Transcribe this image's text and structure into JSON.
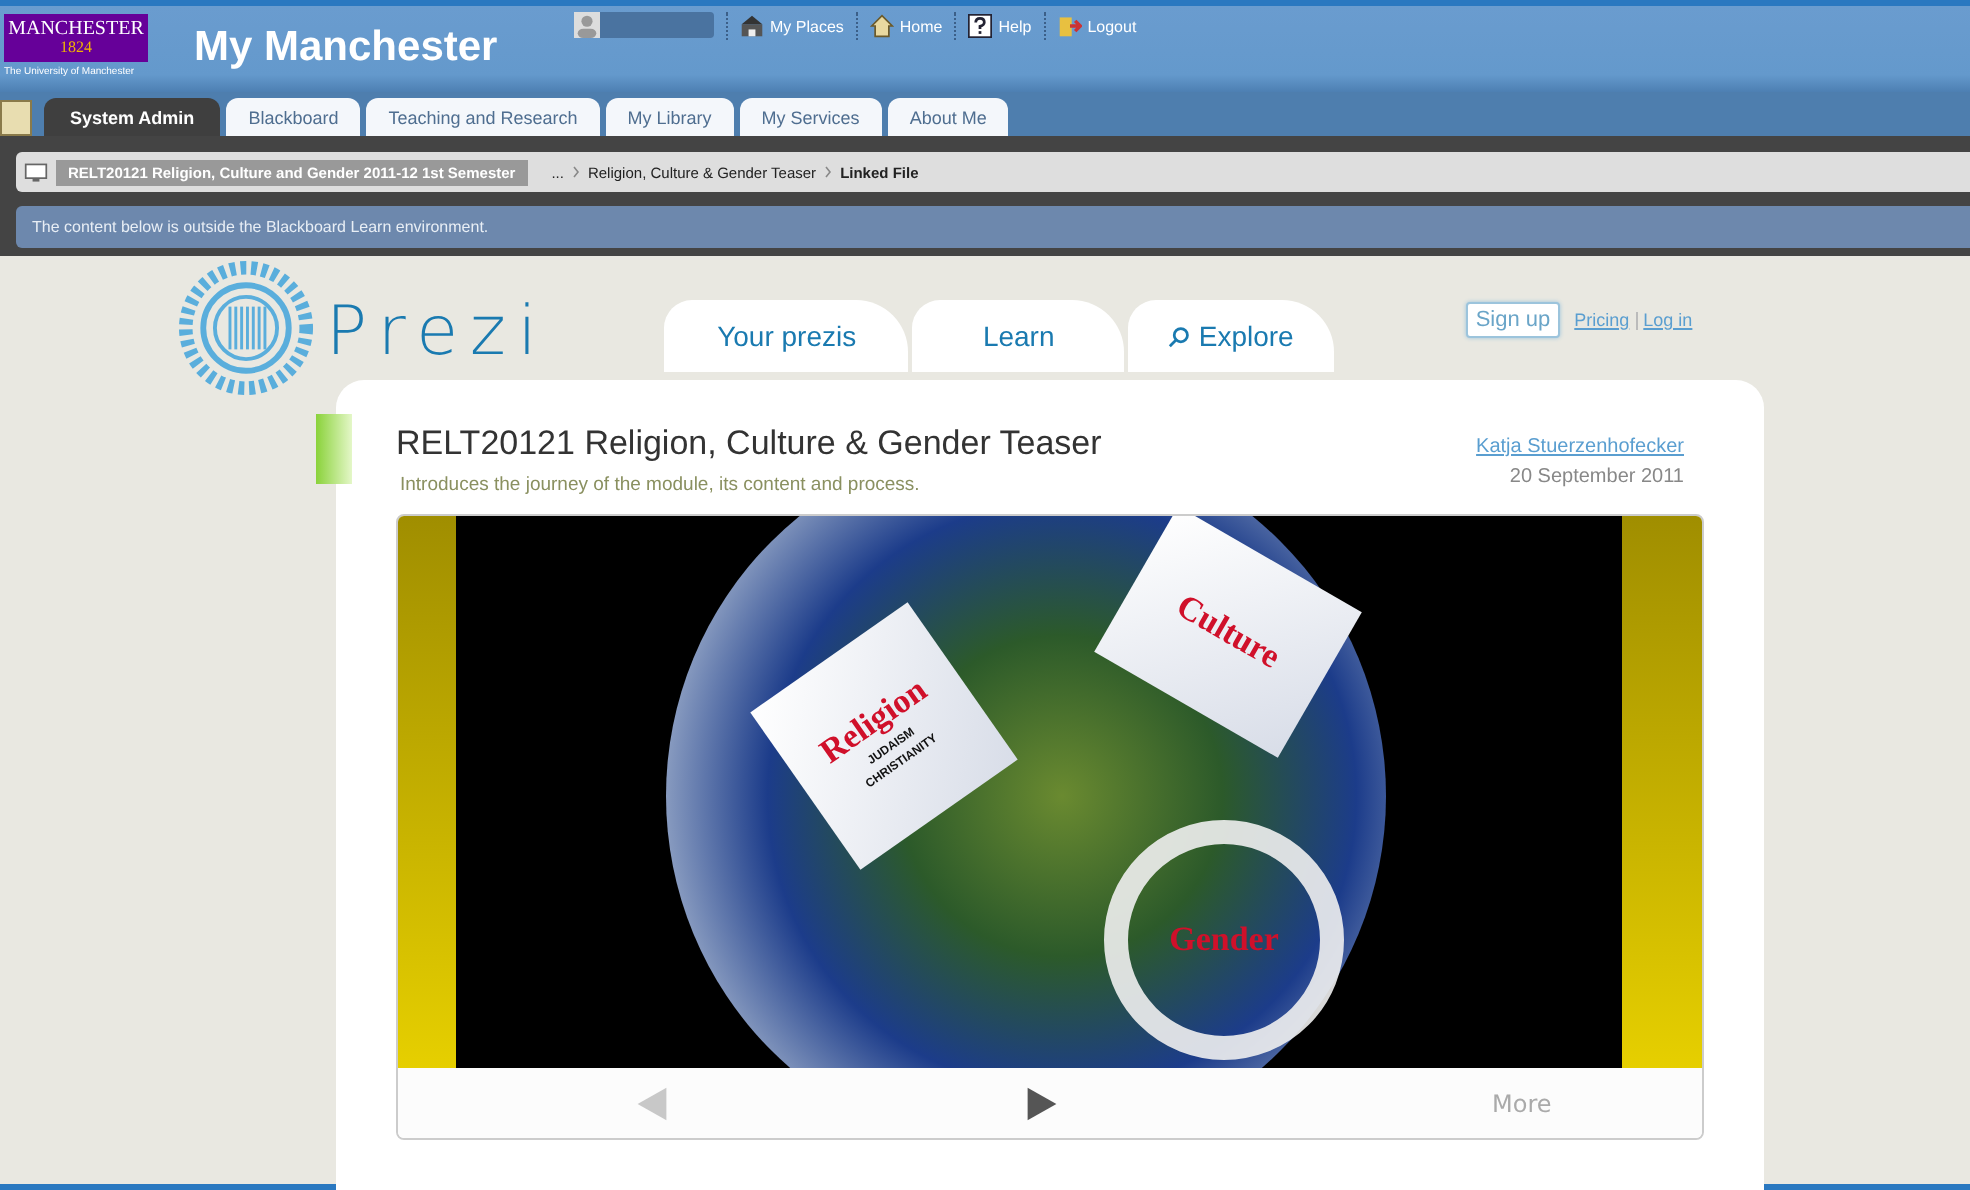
{
  "header": {
    "logo": {
      "name": "MANCHESTER",
      "year": "1824",
      "caption": "The University of Manchester"
    },
    "title": "My Manchester",
    "links": [
      "My Places",
      "Home",
      "Help",
      "Logout"
    ]
  },
  "tabs": [
    {
      "label": "System Admin",
      "selected": true
    },
    {
      "label": "Blackboard",
      "selected": false
    },
    {
      "label": "Teaching and Research",
      "selected": false
    },
    {
      "label": "My Library",
      "selected": false
    },
    {
      "label": "My Services",
      "selected": false
    },
    {
      "label": "About Me",
      "selected": false
    }
  ],
  "breadcrumb": {
    "course": "RELT20121 Religion, Culture and Gender 2011-12 1st Semester",
    "items": [
      "...",
      "Religion, Culture & Gender Teaser",
      "Linked File"
    ]
  },
  "notice": "The content below is outside the Blackboard Learn environment.",
  "prezi": {
    "logo": "Prezi",
    "tabs": [
      "Your prezis",
      "Learn",
      "Explore"
    ],
    "signup": "Sign up",
    "links": [
      "Pricing",
      "Log in"
    ],
    "title": "RELT20121 Religion, Culture & Gender Teaser",
    "description": "Introduces the journey of the module, its content and process.",
    "author": "Katja Stuerzenhofecker",
    "date": "20 September 2011",
    "slides": [
      {
        "title": "Religion",
        "words": [
          "JUDAISM",
          "CHRISTIANITY"
        ]
      },
      {
        "title": "Culture"
      },
      {
        "title": "Gender"
      }
    ],
    "more": "More"
  }
}
